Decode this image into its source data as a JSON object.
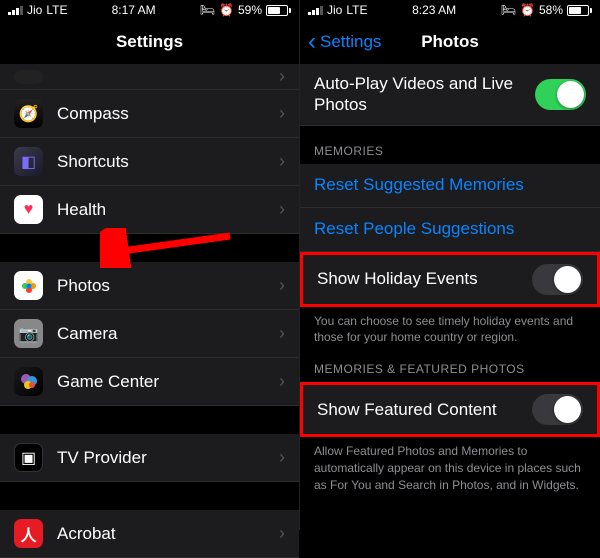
{
  "left": {
    "status": {
      "carrier": "Jio",
      "net": "LTE",
      "time": "8:17 AM",
      "battery": "59%"
    },
    "title": "Settings",
    "rows": {
      "compass": "Compass",
      "shortcuts": "Shortcuts",
      "health": "Health",
      "photos": "Photos",
      "camera": "Camera",
      "gamecenter": "Game Center",
      "tvprovider": "TV Provider",
      "acrobat": "Acrobat"
    }
  },
  "right": {
    "status": {
      "carrier": "Jio",
      "net": "LTE",
      "time": "8:23 AM",
      "battery": "58%"
    },
    "back": "Settings",
    "title": "Photos",
    "autoplay": "Auto-Play Videos and Live Photos",
    "section_memories": "MEMORIES",
    "reset_memories": "Reset Suggested Memories",
    "reset_people": "Reset People Suggestions",
    "holiday": "Show Holiday Events",
    "holiday_footer": "You can choose to see timely holiday events and those for your home country or region.",
    "section_featured": "MEMORIES & FEATURED PHOTOS",
    "featured": "Show Featured Content",
    "featured_footer": "Allow Featured Photos and Memories to automatically appear on this device in places such as For You and Search in Photos, and in Widgets."
  }
}
